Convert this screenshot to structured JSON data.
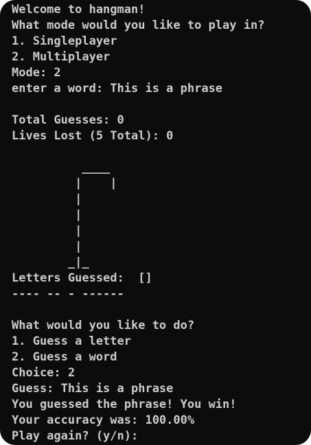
{
  "terminal": {
    "intro": {
      "welcome": "Welcome to hangman!",
      "mode_prompt": "What mode would you like to play in?",
      "option1": "1. Singleplayer",
      "option2": "2. Multiplayer",
      "mode_line": "Mode: 2",
      "word_line": "enter a word: This is a phrase"
    },
    "stats": {
      "total_guesses": "Total Guesses: 0",
      "lives_lost": "Lives Lost (5 Total): 0"
    },
    "gallows": [
      "          ____",
      "         |    |",
      "         |",
      "         |",
      "         |",
      "         |",
      "        _|_"
    ],
    "letters_guessed": "Letters Guessed:  []",
    "masked_word": "---- -- - ------",
    "menu": {
      "prompt": "What would you like to do?",
      "option1": "1. Guess a letter",
      "option2": "2. Guess a word",
      "choice": "Choice: 2",
      "guess": "Guess: This is a phrase",
      "result": "You guessed the phrase! You win!",
      "accuracy": "Your accuracy was: 100.00%",
      "play_again": "Play again? (y/n): "
    },
    "colors": {
      "background": "#0c0c0c",
      "text": "#cccccc"
    }
  }
}
